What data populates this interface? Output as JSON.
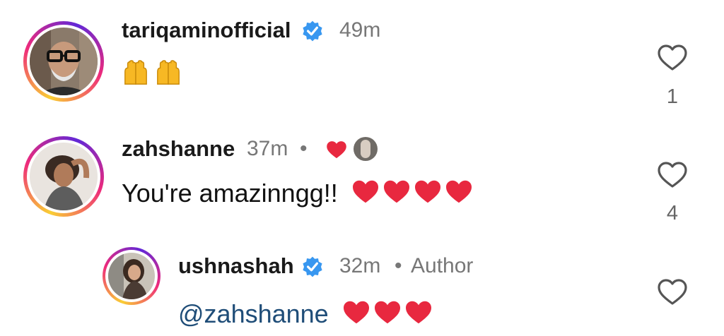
{
  "comments": [
    {
      "username": "tariqaminofficial",
      "verified": true,
      "time": "49m",
      "text": "🙌🙌",
      "likes": "1",
      "avatar_icon": "avatar-bald-man-glasses"
    },
    {
      "username": "zahshanne",
      "verified": false,
      "time": "37m",
      "separator": "•",
      "text": "You're amazinngg!!",
      "text_emoji": "❤❤❤❤",
      "likes": "4",
      "liked_by_author": true,
      "avatar_icon": "avatar-woman-curly-hair"
    },
    {
      "username": "ushnashah",
      "verified": true,
      "time": "32m",
      "separator": "•",
      "role": "Author",
      "mention": "@zahshanne",
      "text_emoji": "❤❤❤",
      "avatar_icon": "avatar-woman-long-hair"
    }
  ],
  "colors": {
    "verified_blue": "#3897f0",
    "heart_red": "#e8283f",
    "mention": "#1f4d78",
    "meta_gray": "#777777"
  }
}
